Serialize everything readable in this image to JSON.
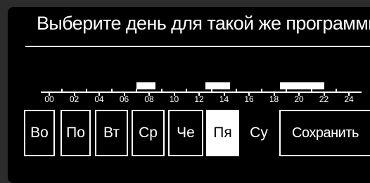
{
  "title": "Выберите день для такой же программы",
  "timeline": {
    "hour_labels": [
      "00",
      "02",
      "04",
      "06",
      "08",
      "10",
      "12",
      "14",
      "16",
      "18",
      "20",
      "22",
      "24"
    ],
    "active_segments": [
      {
        "start_hour": 7.0,
        "end_hour": 8.5
      },
      {
        "start_hour": 12.5,
        "end_hour": 14.5
      },
      {
        "start_hour": 18.5,
        "end_hour": 22.0
      }
    ]
  },
  "days": [
    {
      "label": "Во",
      "selected": false
    },
    {
      "label": "По",
      "selected": false
    },
    {
      "label": "Вт",
      "selected": false
    },
    {
      "label": "Ср",
      "selected": false
    },
    {
      "label": "Че",
      "selected": false
    },
    {
      "label": "Пя",
      "selected": true
    },
    {
      "label": "Су",
      "selected": false
    }
  ],
  "save_label": "Сохранить"
}
